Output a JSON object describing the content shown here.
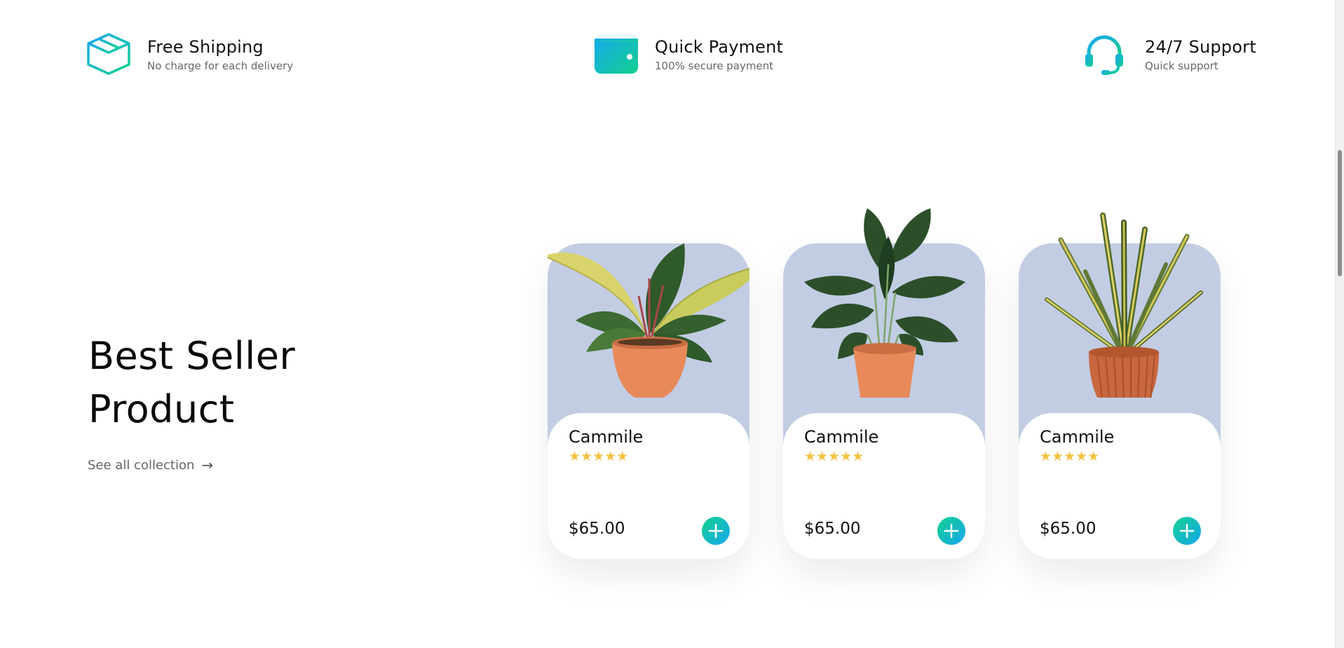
{
  "features": [
    {
      "title": "Free Shipping",
      "subtitle": "No charge for each delivery",
      "icon": "box-icon"
    },
    {
      "title": "Quick Payment",
      "subtitle": "100% secure payment",
      "icon": "wallet-icon"
    },
    {
      "title": "24/7 Support",
      "subtitle": "Quick support",
      "icon": "headset-icon"
    }
  ],
  "section": {
    "title_line1": "Best Seller",
    "title_line2": "Product",
    "see_all": "See all collection",
    "see_all_arrow": "→"
  },
  "products": [
    {
      "name": "Cammile",
      "stars": "★★★★★",
      "price": "$65.00",
      "plant": "philodendron-plant"
    },
    {
      "name": "Cammile",
      "stars": "★★★★★",
      "price": "$65.00",
      "plant": "monstera-plant"
    },
    {
      "name": "Cammile",
      "stars": "★★★★★",
      "price": "$65.00",
      "plant": "snake-plant"
    }
  ],
  "colors": {
    "accent_gradient_start": "#12d18e",
    "accent_gradient_end": "#17a7ef",
    "card_background": "#c2cde3",
    "star": "#f5c242"
  }
}
